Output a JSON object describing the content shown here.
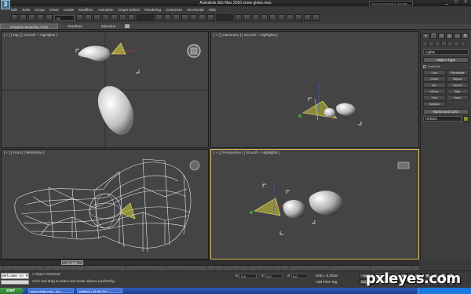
{
  "window": {
    "app_logo": "3",
    "title": "Autodesk 3ds Max 2010    snow globe.max",
    "help_search_placeholder": "Type a keyword or phrase",
    "controls": [
      "_",
      "□",
      "×"
    ]
  },
  "menu": [
    "Edit",
    "Tools",
    "Group",
    "Views",
    "Create",
    "Modifiers",
    "Animation",
    "Graph Editors",
    "Rendering",
    "Customize",
    "MAXScript",
    "Help"
  ],
  "toolbar": {
    "selection_filter": "All"
  },
  "ribbon": {
    "tabs": [
      "Graphite Modeling Tools",
      "Freeform",
      "Selection"
    ]
  },
  "viewports": {
    "top": {
      "label": "[ + ] [ Top ] [ Smooth + Highlights ]"
    },
    "camera": {
      "label": "[ + ] [ Camera01 ] [ Smooth + Highlights ]"
    },
    "front": {
      "label": "[ + ] [ Front ] [ Wireframe ]"
    },
    "perspective": {
      "label": "[ + ] [ Perspective ] [ Smooth + Highlights ]"
    }
  },
  "command_panel": {
    "tab_icons": [
      "plus-icon",
      "bend-icon",
      "hierarchy-icon",
      "motion-icon",
      "display-icon",
      "utilities-icon"
    ],
    "category": "Lights",
    "object_type_header": "Object Type",
    "autogrid_label": "AutoGrid",
    "object_buttons": [
      "Line",
      "Rectangle",
      "Circle",
      "Ellipse",
      "Arc",
      "Donut",
      "NGon",
      "Star",
      "Text",
      "Helix",
      "Section",
      ""
    ],
    "name_color_header": "Name and Color",
    "name_value": "Helix01",
    "swatch_color": "#7a9a2a"
  },
  "timeline": {
    "frame_readout": "0 / 100"
  },
  "status": {
    "maxscript_text": "Welcome to M",
    "selection_msg": "1 Object Selected",
    "prompt_msg": "Click and drag to select and scale objects (uniformly)",
    "x_label": "X:",
    "x_value": "0.0",
    "y_label": "Y:",
    "y_value": "0.0",
    "z_label": "Z:",
    "z_value": "0.0",
    "grid": "Grid = 0.254m",
    "time_tag": "Add Time Tag",
    "auto_key": "Auto Key",
    "set_key": "Set Key",
    "selected_dropdown": "Selected",
    "key_filters": "Key Filters...",
    "frame_value": "0",
    "playback": [
      "|◀",
      "◀",
      "▶",
      "▶|"
    ],
    "nav_glyphs": [
      "⊕",
      "⌕",
      "▣",
      "⊞",
      "⊿",
      "✥",
      "↻",
      "⤢"
    ]
  },
  "taskbar": {
    "start": "start",
    "tasks": [
      "snow globe.max - Au...",
      "untitled-1 @ 66.7% (..."
    ]
  },
  "watermark": "pxleyes.com"
}
